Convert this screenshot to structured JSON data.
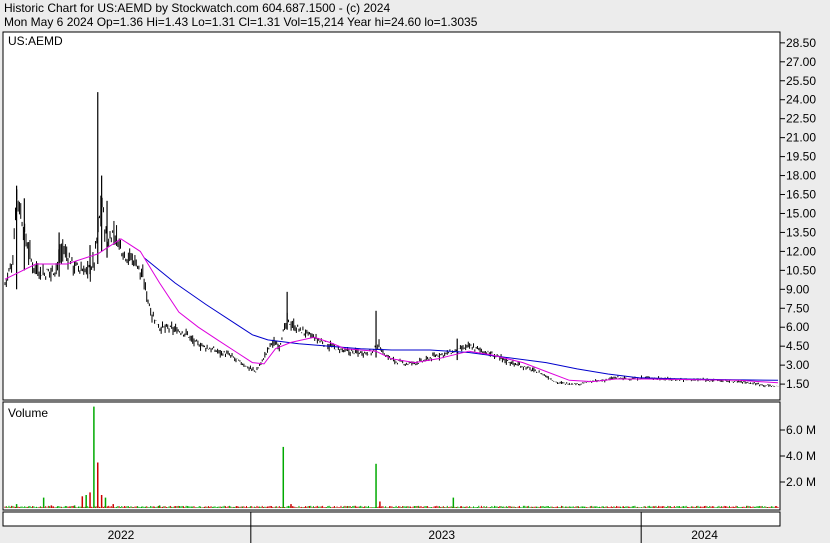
{
  "header": {
    "line1": "Historic Chart for US:AEMD by Stockwatch.com 604.687.1500 - (c) 2024",
    "line2": "Mon May  6 2024  Op=1.36  Hi=1.43  Lo=1.31  Cl=1.31  Vol=15,214  Year hi=24.60  lo=1.3035"
  },
  "colors": {
    "background": "#ececec",
    "panel": "#ffffff",
    "price_bars": "#000000",
    "ma_short": "#dd00dd",
    "ma_long": "#0000cc",
    "volume_up": "#00aa00",
    "volume_down": "#cc0000"
  },
  "chart_data": {
    "type": "line",
    "symbol_label": "US:AEMD",
    "price_panel": {
      "y_ticks": [
        "28.50",
        "27.00",
        "25.50",
        "24.00",
        "22.50",
        "21.00",
        "19.50",
        "18.00",
        "16.50",
        "15.00",
        "13.50",
        "12.00",
        "10.50",
        "9.00",
        "7.50",
        "6.00",
        "4.50",
        "3.00",
        "1.50"
      ],
      "y_range": [
        0.4,
        29.2
      ],
      "x_range": [
        0,
        1
      ],
      "close": [
        [
          0,
          9.5
        ],
        [
          0.01,
          11.2
        ],
        [
          0.015,
          16.8
        ],
        [
          0.025,
          13.5
        ],
        [
          0.035,
          11.0
        ],
        [
          0.05,
          10.2
        ],
        [
          0.065,
          10.6
        ],
        [
          0.075,
          12.2
        ],
        [
          0.09,
          10.8
        ],
        [
          0.105,
          10.4
        ],
        [
          0.115,
          11.0
        ],
        [
          0.125,
          16.0
        ],
        [
          0.132,
          12.5
        ],
        [
          0.14,
          13.6
        ],
        [
          0.155,
          11.8
        ],
        [
          0.17,
          11.2
        ],
        [
          0.18,
          9.5
        ],
        [
          0.19,
          7.0
        ],
        [
          0.2,
          6.0
        ],
        [
          0.22,
          5.8
        ],
        [
          0.235,
          5.5
        ],
        [
          0.245,
          4.8
        ],
        [
          0.26,
          4.4
        ],
        [
          0.275,
          4.1
        ],
        [
          0.29,
          3.8
        ],
        [
          0.305,
          3.2
        ],
        [
          0.315,
          2.8
        ],
        [
          0.325,
          2.5
        ],
        [
          0.335,
          3.6
        ],
        [
          0.345,
          4.8
        ],
        [
          0.355,
          4.6
        ],
        [
          0.365,
          6.5
        ],
        [
          0.375,
          6.0
        ],
        [
          0.39,
          5.5
        ],
        [
          0.405,
          5.0
        ],
        [
          0.42,
          4.5
        ],
        [
          0.44,
          4.1
        ],
        [
          0.46,
          4.0
        ],
        [
          0.475,
          4.0
        ],
        [
          0.483,
          4.6
        ],
        [
          0.492,
          3.8
        ],
        [
          0.505,
          3.3
        ],
        [
          0.52,
          3.1
        ],
        [
          0.54,
          3.3
        ],
        [
          0.56,
          3.8
        ],
        [
          0.585,
          4.1
        ],
        [
          0.6,
          4.5
        ],
        [
          0.615,
          4.2
        ],
        [
          0.635,
          3.7
        ],
        [
          0.655,
          3.2
        ],
        [
          0.675,
          2.8
        ],
        [
          0.695,
          2.3
        ],
        [
          0.715,
          1.6
        ],
        [
          0.74,
          1.5
        ],
        [
          0.76,
          1.7
        ],
        [
          0.775,
          1.8
        ],
        [
          0.79,
          2.0
        ],
        [
          0.81,
          1.9
        ],
        [
          0.83,
          2.0
        ],
        [
          0.86,
          1.9
        ],
        [
          0.89,
          1.85
        ],
        [
          0.92,
          1.8
        ],
        [
          0.95,
          1.7
        ],
        [
          0.97,
          1.55
        ],
        [
          0.985,
          1.4
        ],
        [
          1.0,
          1.31
        ]
      ],
      "spikes": [
        [
          0.015,
          9.0,
          17.2
        ],
        [
          0.025,
          10.5,
          16.2
        ],
        [
          0.07,
          10.0,
          13.5
        ],
        [
          0.11,
          10.2,
          12.5
        ],
        [
          0.12,
          11.0,
          24.6
        ],
        [
          0.125,
          12.0,
          18.0
        ],
        [
          0.132,
          11.5,
          16.0
        ],
        [
          0.365,
          5.8,
          8.8
        ],
        [
          0.48,
          3.6,
          7.3
        ],
        [
          0.585,
          3.4,
          5.1
        ]
      ],
      "ma_short": [
        [
          0,
          9.8
        ],
        [
          0.04,
          11.0
        ],
        [
          0.08,
          11.0
        ],
        [
          0.12,
          11.8
        ],
        [
          0.15,
          13.0
        ],
        [
          0.175,
          12.0
        ],
        [
          0.2,
          9.5
        ],
        [
          0.225,
          7.2
        ],
        [
          0.25,
          6.0
        ],
        [
          0.275,
          5.0
        ],
        [
          0.3,
          4.0
        ],
        [
          0.32,
          3.2
        ],
        [
          0.335,
          3.1
        ],
        [
          0.35,
          4.3
        ],
        [
          0.37,
          4.8
        ],
        [
          0.4,
          5.2
        ],
        [
          0.42,
          4.8
        ],
        [
          0.44,
          4.3
        ],
        [
          0.48,
          4.1
        ],
        [
          0.5,
          3.5
        ],
        [
          0.53,
          3.2
        ],
        [
          0.56,
          3.5
        ],
        [
          0.6,
          4.1
        ],
        [
          0.63,
          3.8
        ],
        [
          0.67,
          3.2
        ],
        [
          0.7,
          2.5
        ],
        [
          0.73,
          1.8
        ],
        [
          0.76,
          1.7
        ],
        [
          0.79,
          1.9
        ],
        [
          0.83,
          1.9
        ],
        [
          0.9,
          1.85
        ],
        [
          0.95,
          1.8
        ],
        [
          1.0,
          1.6
        ]
      ],
      "ma_long": [
        [
          0.18,
          11.5
        ],
        [
          0.22,
          9.5
        ],
        [
          0.26,
          7.8
        ],
        [
          0.3,
          6.2
        ],
        [
          0.32,
          5.4
        ],
        [
          0.34,
          5.0
        ],
        [
          0.38,
          4.7
        ],
        [
          0.42,
          4.5
        ],
        [
          0.46,
          4.3
        ],
        [
          0.5,
          4.2
        ],
        [
          0.55,
          4.2
        ],
        [
          0.6,
          4.0
        ],
        [
          0.65,
          3.6
        ],
        [
          0.7,
          3.2
        ],
        [
          0.74,
          2.7
        ],
        [
          0.78,
          2.3
        ],
        [
          0.82,
          2.0
        ],
        [
          0.88,
          1.9
        ],
        [
          0.94,
          1.85
        ],
        [
          1.0,
          1.8
        ]
      ]
    },
    "volume_panel": {
      "title": "Volume",
      "y_ticks": [
        "6.0 M",
        "4.0 M",
        "2.0 M"
      ],
      "y_range": [
        0,
        8.0
      ],
      "bars": [
        [
          0.015,
          0.3,
          "up"
        ],
        [
          0.05,
          0.8,
          "up"
        ],
        [
          0.06,
          0.2,
          "down"
        ],
        [
          0.09,
          0.2,
          "up"
        ],
        [
          0.1,
          0.9,
          "down"
        ],
        [
          0.105,
          1.0,
          "up"
        ],
        [
          0.11,
          1.2,
          "down"
        ],
        [
          0.115,
          7.8,
          "up"
        ],
        [
          0.12,
          3.5,
          "down"
        ],
        [
          0.125,
          1.0,
          "down"
        ],
        [
          0.13,
          0.8,
          "up"
        ],
        [
          0.14,
          0.3,
          "down"
        ],
        [
          0.2,
          0.2,
          "up"
        ],
        [
          0.3,
          0.15,
          "down"
        ],
        [
          0.36,
          4.7,
          "up"
        ],
        [
          0.37,
          0.3,
          "down"
        ],
        [
          0.48,
          3.4,
          "up"
        ],
        [
          0.485,
          0.5,
          "down"
        ],
        [
          0.58,
          0.8,
          "up"
        ],
        [
          0.59,
          0.15,
          "down"
        ],
        [
          0.75,
          0.1,
          "up"
        ],
        [
          0.8,
          0.1,
          "down"
        ]
      ]
    },
    "x_axis": {
      "labels": [
        "2022",
        "2023",
        "2024"
      ],
      "label_positions": [
        0.15,
        0.565,
        0.905
      ],
      "dividers": [
        0.318,
        0.823
      ]
    }
  }
}
